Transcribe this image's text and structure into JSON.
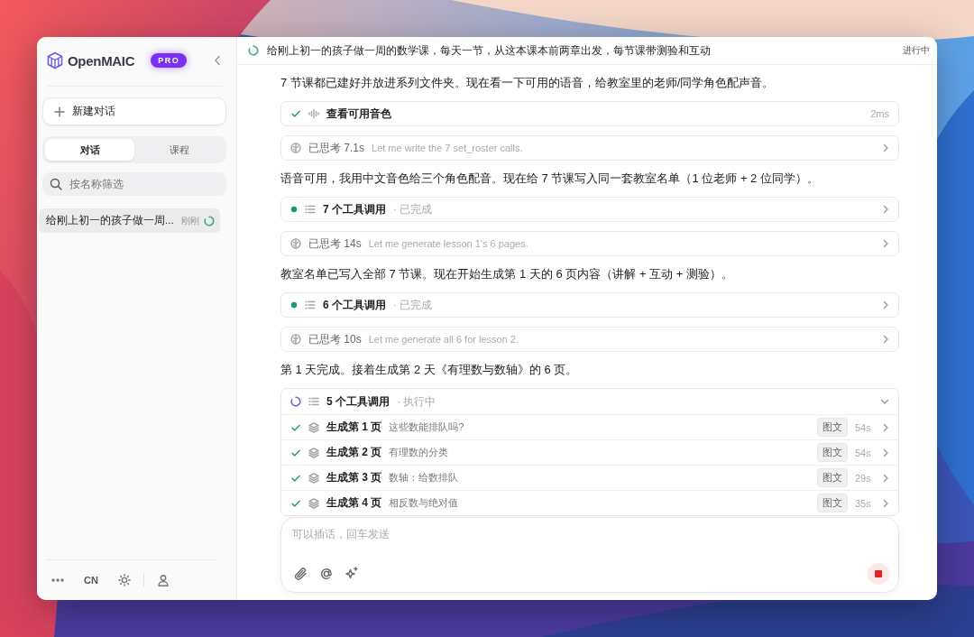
{
  "sidebar": {
    "logo": "OpenMAIC",
    "badge": "PRO",
    "new_chat": "新建对话",
    "tabs": [
      {
        "label": "对话",
        "selected": true
      },
      {
        "label": "课程",
        "selected": false
      }
    ],
    "search": {
      "placeholder": "按名称筛选"
    },
    "conversations": [
      {
        "title": "给刚上初一的孩子做一周...",
        "time": "刚刚",
        "running": true,
        "selected": true
      }
    ],
    "footer": {
      "language": "CN"
    }
  },
  "header": {
    "title": "给刚上初一的孩子做一周的数学课，每天一节，从这本课本前两章出发，每节课带测验和互动",
    "status": "进行中",
    "running": true
  },
  "messages": [
    {
      "kind": "text",
      "text": "7 节课都已建好并放进系列文件夹。现在看一下可用的语音，给教室里的老师/同学角色配声音。"
    },
    {
      "kind": "tool",
      "done": true,
      "name": "查看可用音色",
      "duration": "2ms"
    },
    {
      "kind": "thinking",
      "label": "已思考 7.1s",
      "summary": "Let me write the 7 set_roster calls."
    },
    {
      "kind": "text",
      "text": "语音可用，我用中文音色给三个角色配音。现在给 7 节课写入同一套教室名单（1 位老师 + 2 位同学）。"
    },
    {
      "kind": "tool_group",
      "done": true,
      "label": "7 个工具调用",
      "state": "· 已完成",
      "expanded": false
    },
    {
      "kind": "thinking",
      "label": "已思考 14s",
      "summary": "Let me generate lesson 1's 6 pages."
    },
    {
      "kind": "text",
      "text": "教室名单已写入全部 7 节课。现在开始生成第 1 天的 6 页内容（讲解 + 互动 + 测验）。"
    },
    {
      "kind": "tool_group",
      "done": true,
      "label": "6 个工具调用",
      "state": "· 已完成",
      "expanded": false
    },
    {
      "kind": "thinking",
      "label": "已思考 10s",
      "summary": "Let me generate all 6 for lesson 2."
    },
    {
      "kind": "text",
      "text": "第 1 天完成。接着生成第 2 天《有理数与数轴》的 6 页。"
    },
    {
      "kind": "tool_group",
      "done": false,
      "label": "5 个工具调用",
      "state": "· 执行中",
      "expanded": true,
      "children": [
        {
          "title": "生成第 1 页",
          "subtitle": "这些数能排队吗?",
          "tag": "图文",
          "duration": "54s",
          "done": true
        },
        {
          "title": "生成第 2 页",
          "subtitle": "有理数的分类",
          "tag": "图文",
          "duration": "54s",
          "done": true
        },
        {
          "title": "生成第 3 页",
          "subtitle": "数轴：给数排队",
          "tag": "图文",
          "duration": "29s",
          "done": true
        },
        {
          "title": "生成第 4 页",
          "subtitle": "相反数与绝对值",
          "tag": "图文",
          "duration": "35s",
          "done": true
        }
      ]
    }
  ],
  "composer": {
    "placeholder": "可以插话，回车发送",
    "generating": true
  }
}
